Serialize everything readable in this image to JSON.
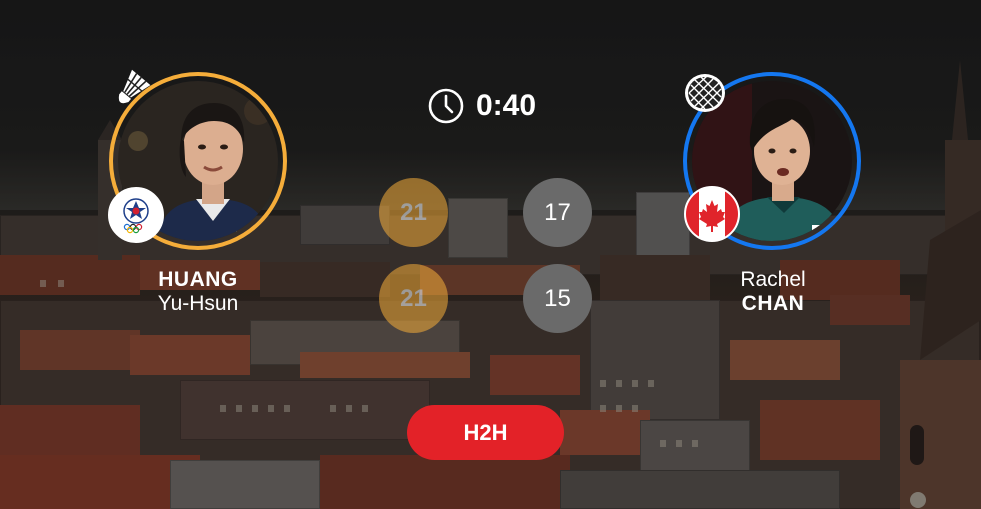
{
  "match": {
    "duration": "0:40"
  },
  "players": {
    "left": {
      "last_name": "HUANG",
      "first_name": "Yu-Hsun",
      "flag_icon": "chinese-taipei-flag-icon",
      "ring_color": "#f5ad3a",
      "serve_indicator": "shuttlecock-icon"
    },
    "right": {
      "first_name": "Rachel",
      "last_name": "CHAN",
      "flag_icon": "canada-flag-icon",
      "ring_color": "#1477f0",
      "indicator": "racket-icon"
    }
  },
  "games": [
    {
      "left": "21",
      "right": "17",
      "winner": "left"
    },
    {
      "left": "21",
      "right": "15",
      "winner": "left"
    }
  ],
  "buttons": {
    "h2h_label": "H2H"
  },
  "colors": {
    "winner": "#f5ad3a",
    "loser": "#6a6a6a",
    "h2h": "#e32228"
  }
}
